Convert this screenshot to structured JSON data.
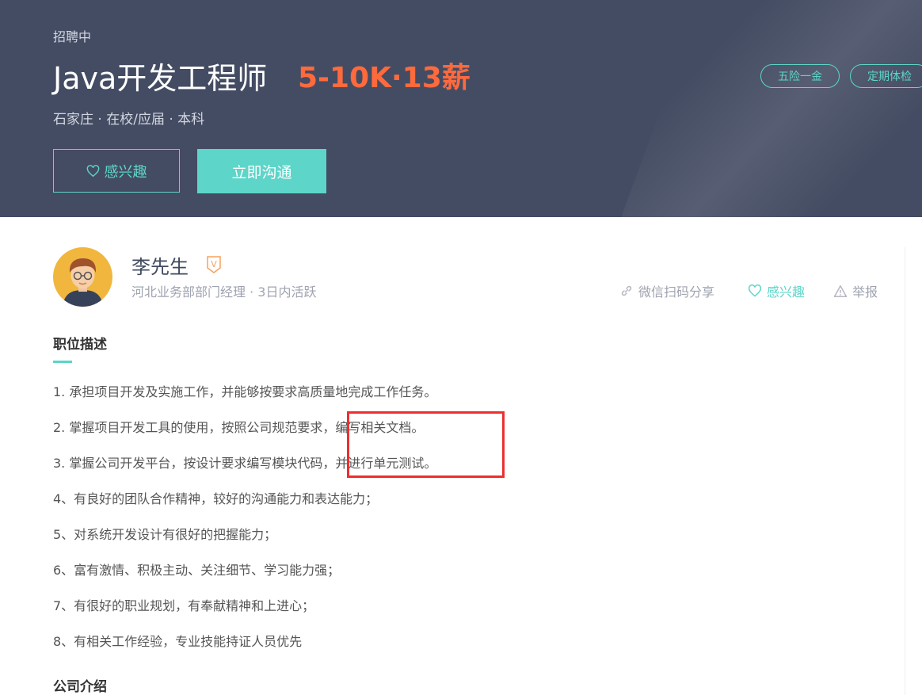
{
  "header": {
    "status": "招聘中",
    "job_title": "Java开发工程师",
    "salary": "5-10K·13薪",
    "meta": "石家庄 · 在校/应届 · 本科",
    "interest_label": "感兴趣",
    "chat_label": "立即沟通",
    "tags": [
      "五险一金",
      "定期体检"
    ]
  },
  "boss": {
    "name": "李先生",
    "badge": "V",
    "meta": "河北业务部部门经理 ·  3日内活跃"
  },
  "actions": {
    "share": "微信扫码分享",
    "interest": "感兴趣",
    "report": "举报"
  },
  "description": {
    "title": "职位描述",
    "items": [
      "1. 承担项目开发及实施工作，并能够按要求高质量地完成工作任务。",
      "2. 掌握项目开发工具的使用，按照公司规范要求，编写相关文档。",
      "3. 掌握公司开发平台，按设计要求编写模块代码，并进行单元测试。",
      "4、有良好的团队合作精神，较好的沟通能力和表达能力；",
      "5、对系统开发设计有很好的把握能力；",
      "6、富有激情、积极主动、关注细节、学习能力强；",
      "7、有很好的职业规划，有奉献精神和上进心；",
      "8、有相关工作经验，专业技能持证人员优先"
    ]
  },
  "company": {
    "title": "公司介绍"
  },
  "colors": {
    "banner_bg": "#444c63",
    "accent": "#5dd5c8",
    "salary": "#ff6a3d",
    "highlight": "#ec2f2f"
  }
}
